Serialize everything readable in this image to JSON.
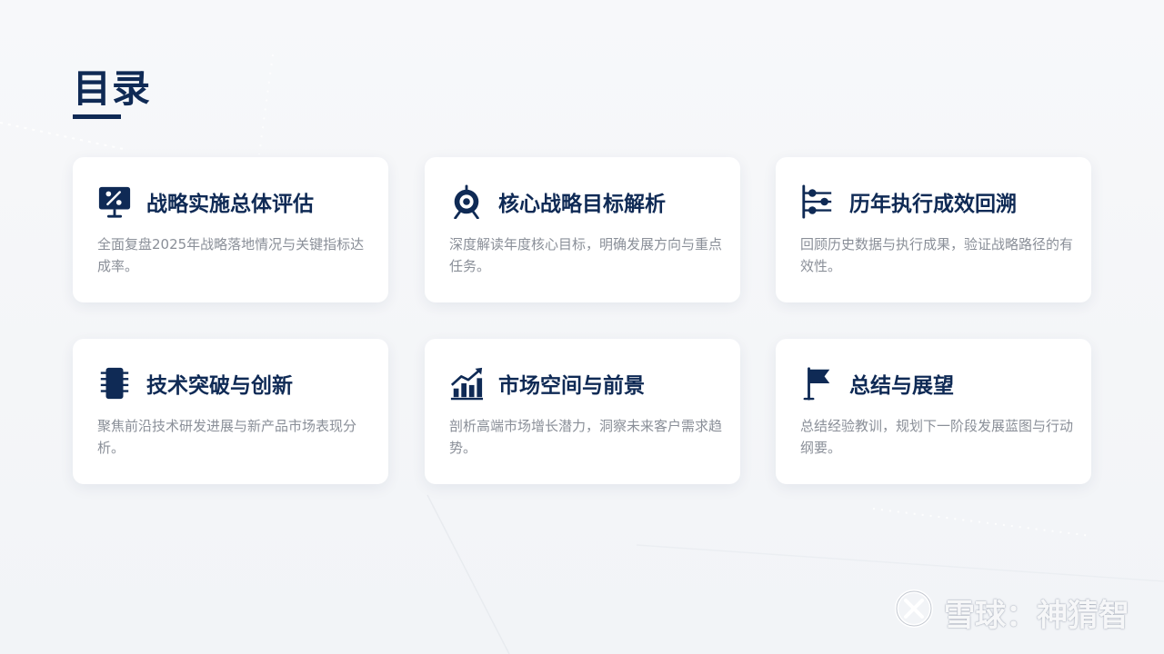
{
  "page": {
    "title": "目录"
  },
  "colors": {
    "accent": "#0f2a55",
    "card_bg": "#ffffff",
    "desc_text": "#8a8f98",
    "background": "#f4f5f8"
  },
  "cards": [
    {
      "icon": "presentation-percent-icon",
      "title": "战略实施总体评估",
      "desc": "全面复盘2025年战略落地情况与关键指标达成率。"
    },
    {
      "icon": "target-icon",
      "title": "核心战略目标解析",
      "desc": "深度解读年度核心目标，明确发展方向与重点任务。"
    },
    {
      "icon": "timeline-icon",
      "title": "历年执行成效回溯",
      "desc": "回顾历史数据与执行成果，验证战略路径的有效性。"
    },
    {
      "icon": "chip-icon",
      "title": "技术突破与创新",
      "desc": "聚焦前沿技术研发进展与新产品市场表现分析。"
    },
    {
      "icon": "growth-chart-icon",
      "title": "市场空间与前景",
      "desc": "剖析高端市场增长潜力，洞察未来客户需求趋势。"
    },
    {
      "icon": "flag-icon",
      "title": "总结与展望",
      "desc": "总结经验教训，规划下一阶段发展蓝图与行动纲要。"
    }
  ],
  "watermark": {
    "text": "雪球：神猜智"
  }
}
